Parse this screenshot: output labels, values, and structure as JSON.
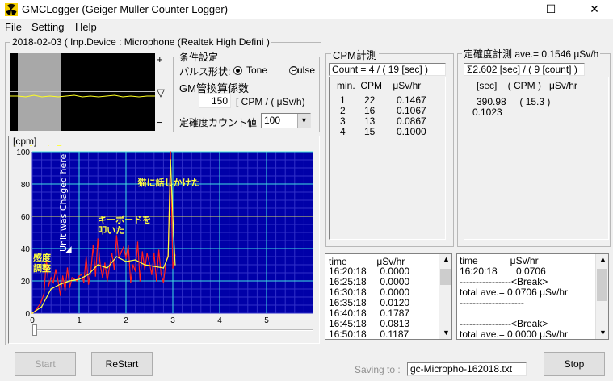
{
  "window": {
    "title": "GMCLogger (Geiger Muller Counter Logger)",
    "min": "—",
    "max": "☐",
    "close": "✕"
  },
  "menu": [
    "File",
    "Setting",
    "Help"
  ],
  "session": {
    "label": "2018-02-03 ( Inp.Device : Microphone (Realtek High Defini )"
  },
  "waveform": {
    "plus": "+",
    "minus": "−",
    "marker": "▽"
  },
  "conditions": {
    "title": "条件設定",
    "pulse_label": "パルス形状:",
    "tone": "Tone",
    "pulse": "Pulse",
    "selected": "tone",
    "factor_label": "GM管換算係数",
    "factor_value": "150",
    "factor_unit": "[ CPM / ( μSv/h)",
    "count_label": "定確度カウント値",
    "count_value": "100"
  },
  "cpm": {
    "title": "CPM計測",
    "summary": "Count = 4 / ( 19 [sec] )",
    "headers": "min.  CPM    μSv/hr",
    "rows": [
      {
        "min": "1",
        "cpm": "22",
        "usv": "0.1467"
      },
      {
        "min": "2",
        "cpm": "16",
        "usv": "0.1067"
      },
      {
        "min": "3",
        "cpm": "13",
        "usv": "0.0867"
      },
      {
        "min": "4",
        "cpm": "15",
        "usv": "0.1000"
      }
    ]
  },
  "accuracy": {
    "title": "定確度計測 ave.= 0.1546 μSv/h",
    "summary": "Σ2.602 [sec] / ( 9 [count] )",
    "headers": "[sec]    ( CPM )   μSv/hr",
    "line1": "390.98     ( 15.3 )",
    "line2": "0.1023"
  },
  "chart_data": {
    "type": "line",
    "ylabel": "[cpm]",
    "ylim": [
      0,
      100
    ],
    "xlim": [
      0,
      6
    ],
    "yticks": [
      "0",
      "20",
      "40",
      "60",
      "80",
      "100"
    ],
    "xticks": [
      "0",
      "1",
      "2",
      "3",
      "4",
      "5"
    ],
    "series": [
      {
        "color": "#ff2020",
        "x": [
          0.0,
          0.05,
          0.1,
          0.15,
          0.2,
          0.25,
          0.3,
          0.35,
          0.4,
          0.45,
          0.5,
          0.55,
          0.6,
          0.65,
          0.7,
          0.75,
          0.8,
          0.85,
          0.9,
          0.95,
          1.0,
          1.05,
          1.1,
          1.15,
          1.2,
          1.25,
          1.3,
          1.35,
          1.4,
          1.45,
          1.5,
          1.55,
          1.6,
          1.65,
          1.7,
          1.75,
          1.8,
          1.85,
          1.9,
          1.95,
          2.0,
          2.05,
          2.1,
          2.15,
          2.2,
          2.25,
          2.3,
          2.35,
          2.4,
          2.45,
          2.5,
          2.55,
          2.6,
          2.65,
          2.7,
          2.75,
          2.8,
          2.85,
          2.9,
          2.95,
          3.0,
          3.05
        ],
        "values": [
          0,
          1,
          3,
          5,
          8,
          12,
          33,
          17,
          22,
          19,
          27,
          20,
          11,
          23,
          14,
          28,
          16,
          22,
          21,
          20,
          23,
          24,
          19,
          35,
          18,
          26,
          42,
          23,
          46,
          30,
          22,
          31,
          20,
          29,
          37,
          27,
          48,
          34,
          38,
          41,
          34,
          42,
          19,
          30,
          26,
          44,
          20,
          38,
          27,
          37,
          31,
          24,
          37,
          20,
          39,
          24,
          19,
          31,
          36,
          100,
          28,
          36
        ]
      },
      {
        "color": "#ffff40",
        "x": [
          0.0,
          0.2,
          0.4,
          0.6,
          0.8,
          1.0,
          1.2,
          1.4,
          1.6,
          1.8,
          2.0,
          2.2,
          2.4,
          2.6,
          2.8,
          2.9,
          2.95,
          3.0,
          3.05
        ],
        "values": [
          0,
          4,
          15,
          18,
          20,
          21,
          24,
          30,
          28,
          35,
          32,
          33,
          30,
          29,
          28,
          35,
          95,
          60,
          30
        ]
      }
    ],
    "annotations": [
      {
        "text": "感度\n調整",
        "x": 0.02,
        "y": 68
      },
      {
        "text": "Unit was Chaged here",
        "x": 0.78,
        "y": 70
      },
      {
        "text": "キーボードを\n叩いた",
        "x": 2.0,
        "y": 97
      },
      {
        "text": "猫に話しかけた",
        "x": 2.9,
        "y": 127
      }
    ]
  },
  "log1": {
    "headers": "time           μSv/hr",
    "rows": [
      "16:20:18     0.0000",
      "16:25:18     0.0000",
      "16:30:18     0.0000",
      "16:35:18     0.0120",
      "16:40:18     0.1787",
      "16:45:18     0.0813",
      "16:50:18     0.1187"
    ]
  },
  "log2": {
    "rows": [
      "time            μSv/hr",
      "16:20:18       0.0706",
      "----------------<Break>",
      "total ave.= 0.0706 μSv/hr",
      "--------------------",
      "",
      "----------------<Break>",
      "total ave.= 0.0000 μSv/hr"
    ]
  },
  "bottom": {
    "start": "Start",
    "restart": "ReStart",
    "saving_label": "Saving to :",
    "saving_file": "gc-Micropho-162018.txt",
    "stop": "Stop"
  }
}
